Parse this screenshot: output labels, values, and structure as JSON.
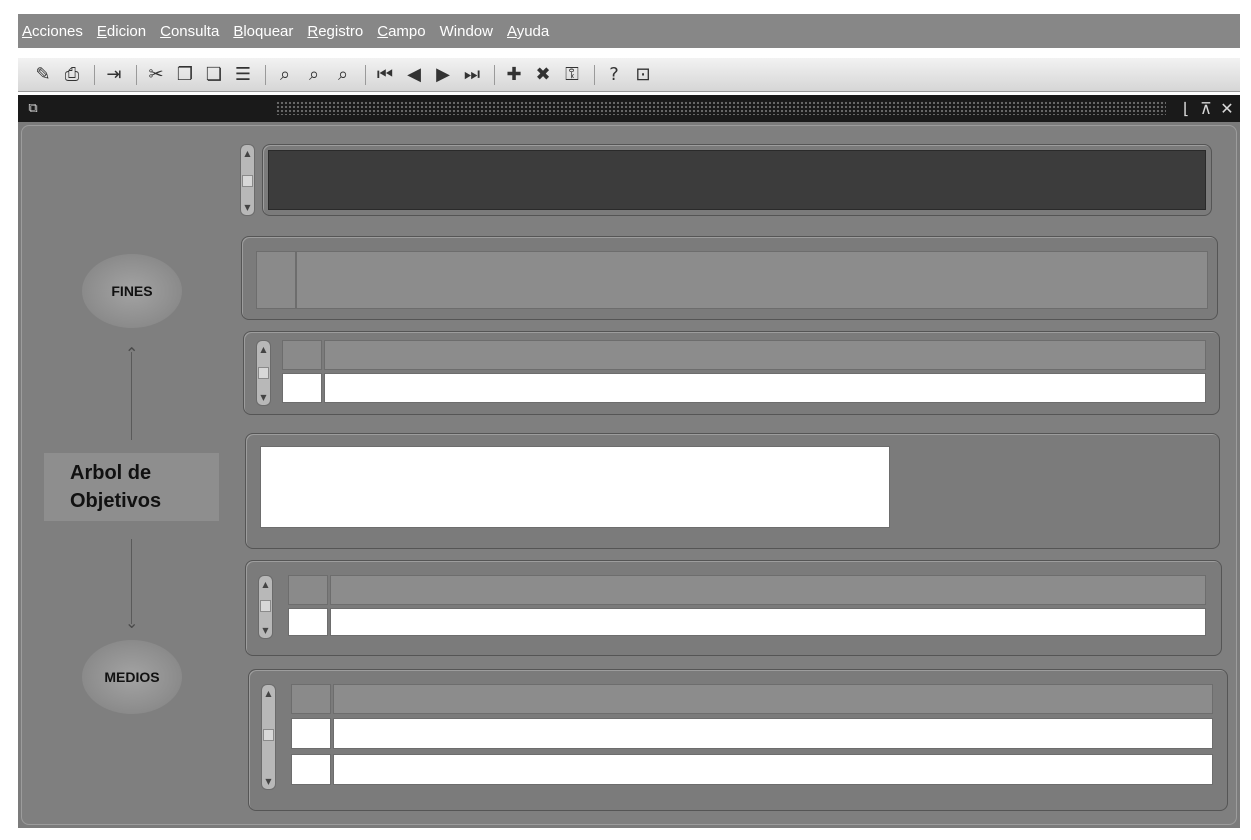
{
  "menubar": {
    "items": [
      {
        "label": "Acciones",
        "mnemonic": "A",
        "rest": "cciones"
      },
      {
        "label": "Edicion",
        "mnemonic": "E",
        "rest": "dicion"
      },
      {
        "label": "Consulta",
        "mnemonic": "C",
        "rest": "onsulta"
      },
      {
        "label": "Bloquear",
        "mnemonic": "B",
        "rest": "loquear"
      },
      {
        "label": "Registro",
        "mnemonic": "R",
        "rest": "egistro"
      },
      {
        "label": "Campo",
        "mnemonic": "C",
        "rest": "ampo"
      },
      {
        "label": "Window",
        "mnemonic": "",
        "rest": "Window"
      },
      {
        "label": "Ayuda",
        "mnemonic": "A",
        "rest": "yuda"
      }
    ]
  },
  "toolbar": {
    "icons": {
      "save": "✎",
      "print": "⎙",
      "exit": "⇥",
      "cut": "✂",
      "copy": "❐",
      "paste": "❏",
      "edit": "☰",
      "enter_query": "⌕",
      "execute_query": "⌕",
      "cancel_query": "⌕",
      "first": "⏮",
      "prev": "◀",
      "next": "▶",
      "last": "⏭",
      "new_record": "✚",
      "delete_record": "✖",
      "lock": "⚿",
      "help": "?",
      "zoom": "⊡"
    }
  },
  "window": {
    "icon_glyph": "⧉",
    "minimize_glyph": "⌊",
    "maximize_glyph": "⊼",
    "close_glyph": "✕"
  },
  "diagram": {
    "fines_label": "FINES",
    "arbol_line1": "Arbol de",
    "arbol_line2": "Objetivos",
    "medios_label": "MEDIOS",
    "arrow_up": "⌃",
    "arrow_down": "⌄"
  },
  "scrollbar": {
    "up": "▲",
    "down": "▼"
  }
}
